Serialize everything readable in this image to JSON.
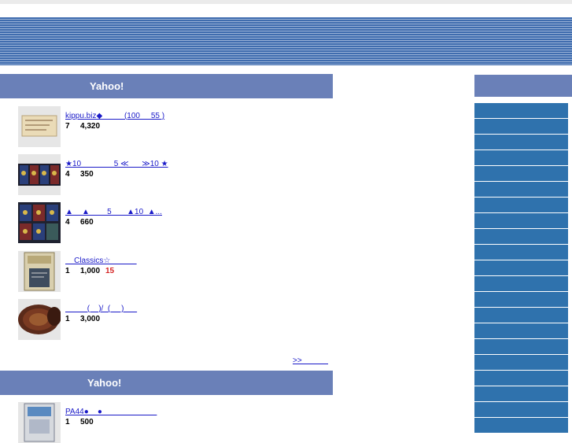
{
  "header": {
    "section1_title": "Yahoo!",
    "section2_title": "Yahoo!"
  },
  "items": [
    {
      "title": "kippu.biz◆          (100     55 )",
      "bids": "7",
      "price": "4,320",
      "time": ""
    },
    {
      "title": "★10               5 ≪      ≫10 ★",
      "bids": "4",
      "price": "350",
      "time": ""
    },
    {
      "title": "▲    ▲        5       ▲10  ▲...",
      "bids": "4",
      "price": "660",
      "time": ""
    },
    {
      "title": "    Classics☆            ",
      "bids": "1",
      "price": "1,000",
      "time": "15"
    },
    {
      "title": "          (    )/  (     )      ",
      "bids": "1",
      "price": "3,000",
      "time": ""
    }
  ],
  "more_link": ">>            ",
  "section2_items": [
    {
      "title": "PA44●    ●                         ",
      "bids": "1",
      "price": "500",
      "time": ""
    }
  ],
  "colors": {
    "header_bg": "#6a80b8",
    "sidebar_bg": "#2f72ad",
    "link": "#1a1ac8",
    "countdown": "#d42222"
  },
  "thumbnail_icons": [
    "ticket-image",
    "cards-image",
    "cards-image",
    "book-image",
    "plate-image",
    "book-image"
  ]
}
